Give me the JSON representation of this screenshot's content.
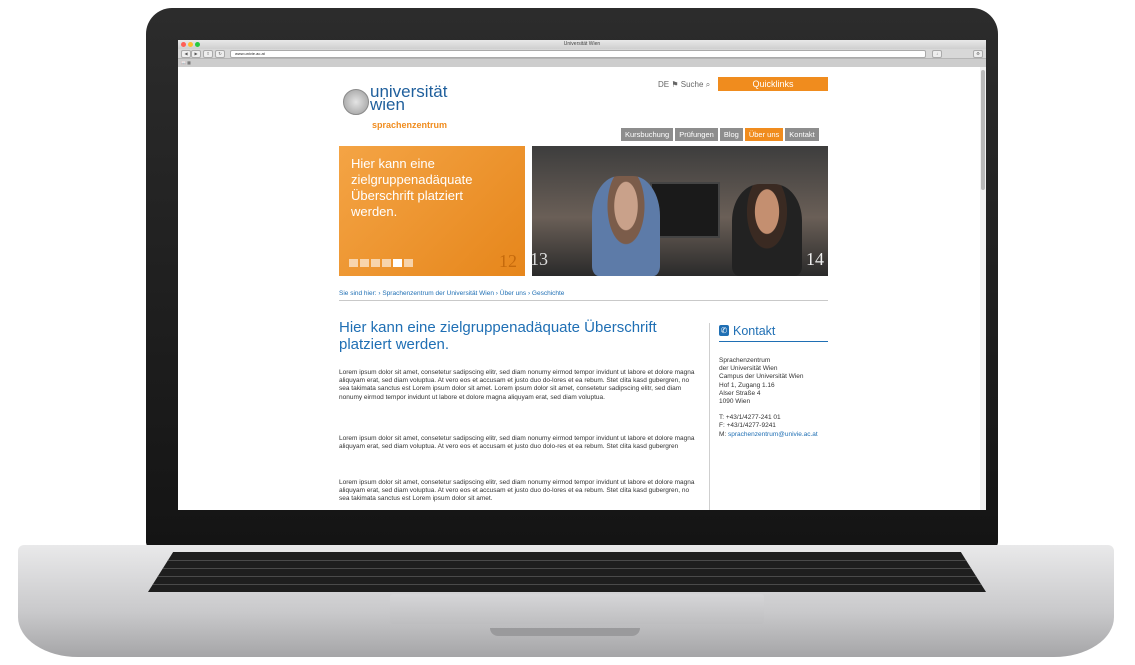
{
  "browser": {
    "window_title": "Universität Wien",
    "url": "www.univie.ac.at"
  },
  "header": {
    "lang": "DE",
    "search_label": "Suche",
    "quicklinks_label": "Quicklinks",
    "logo_main": "universität\nwien",
    "logo_sub": "sprachenzentrum"
  },
  "nav": {
    "items": [
      {
        "label": "Kursbuchung",
        "active": false
      },
      {
        "label": "Prüfungen",
        "active": false
      },
      {
        "label": "Blog",
        "active": false
      },
      {
        "label": "Über uns",
        "active": true
      },
      {
        "label": "Kontakt",
        "active": false
      }
    ]
  },
  "hero": {
    "text": "Hier kann eine zielgruppenadäquate Überschrift platziert werden.",
    "slide_count": 6,
    "active_slide": 5,
    "left_number": "12",
    "right_number_left": "13",
    "right_number_right": "14"
  },
  "breadcrumb": "Sie sind hier: › Sprachenzentrum der Universität Wien › Über uns › Geschichte",
  "main": {
    "heading": "Hier kann eine zielgruppenadäquate Überschrift platziert werden.",
    "paragraphs": [
      "Lorem ipsum dolor sit amet, consetetur sadipscing elitr, sed diam nonumy eirmod tempor invidunt ut labore et dolore magna aliquyam erat, sed diam voluptua. At vero eos et accusam et justo duo do-lores et ea rebum. Stet clita kasd gubergren, no sea takimata sanctus est Lorem ipsum dolor sit amet. Lorem ipsum dolor sit amet, consetetur sadipscing elitr, sed diam nonumy eirmod tempor invidunt ut labore et dolore magna aliquyam erat, sed diam voluptua.",
      "Lorem ipsum dolor sit amet, consetetur sadipscing elitr, sed diam nonumy eirmod tempor invidunt ut labore et dolore magna aliquyam erat, sed diam voluptua. At vero eos et accusam et justo duo dolo-res et ea rebum. Stet clita kasd gubergren",
      "Lorem ipsum dolor sit amet, consetetur sadipscing elitr, sed diam nonumy eirmod tempor invidunt ut labore et dolore magna aliquyam erat, sed diam voluptua. At vero eos et accusam et justo duo do-lores et ea rebum. Stet clita kasd gubergren, no sea takimata sanctus est Lorem ipsum dolor sit amet."
    ]
  },
  "kontakt": {
    "title": "Kontakt",
    "address": [
      "Sprachenzentrum",
      "der Universität Wien",
      "Campus der Universität Wien",
      "Hof 1, Zugang 1.16",
      "Alser Straße 4",
      "1090 Wien"
    ],
    "phone": "T: +43/1/4277-241 01",
    "fax": "F: +43/1/4277-9241",
    "email_prefix": "M: ",
    "email": "sprachenzentrum@univie.ac.at"
  },
  "colors": {
    "accent": "#f08c1e",
    "brand_blue": "#1f6fb4",
    "nav_grey": "#8d8d8d"
  }
}
